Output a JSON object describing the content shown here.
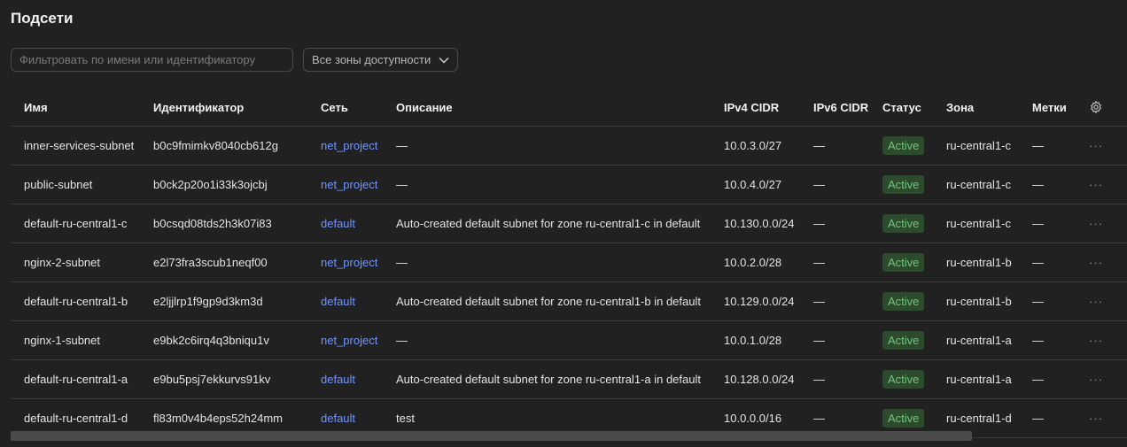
{
  "page": {
    "title": "Подсети"
  },
  "filter": {
    "placeholder": "Фильтровать по имени или идентификатору"
  },
  "zone_select": {
    "value": "Все зоны доступности",
    "icon": "chevron-down-icon"
  },
  "table": {
    "columns": [
      "Имя",
      "Идентификатор",
      "Сеть",
      "Описание",
      "IPv4 CIDR",
      "IPv6 CIDR",
      "Статус",
      "Зона",
      "Метки"
    ],
    "settings_icon": "gear-icon",
    "rows": [
      {
        "name": "inner-services-subnet",
        "id": "b0c9fmimkv8040cb612g",
        "network": "net_project",
        "description": "—",
        "ipv4": "10.0.3.0/27",
        "ipv6": "—",
        "status": "Active",
        "zone": "ru-central1-c",
        "labels": "—",
        "actions": "···"
      },
      {
        "name": "public-subnet",
        "id": "b0ck2p20o1i33k3ojcbj",
        "network": "net_project",
        "description": "—",
        "ipv4": "10.0.4.0/27",
        "ipv6": "—",
        "status": "Active",
        "zone": "ru-central1-c",
        "labels": "—",
        "actions": "···"
      },
      {
        "name": "default-ru-central1-c",
        "id": "b0csqd08tds2h3k07i83",
        "network": "default",
        "description": "Auto-created default subnet for zone ru-central1-c in default",
        "ipv4": "10.130.0.0/24",
        "ipv6": "—",
        "status": "Active",
        "zone": "ru-central1-c",
        "labels": "—",
        "actions": "···"
      },
      {
        "name": "nginx-2-subnet",
        "id": "e2l73fra3scub1neqf00",
        "network": "net_project",
        "description": "—",
        "ipv4": "10.0.2.0/28",
        "ipv6": "—",
        "status": "Active",
        "zone": "ru-central1-b",
        "labels": "—",
        "actions": "···"
      },
      {
        "name": "default-ru-central1-b",
        "id": "e2ljjlrp1f9gp9d3km3d",
        "network": "default",
        "description": "Auto-created default subnet for zone ru-central1-b in default",
        "ipv4": "10.129.0.0/24",
        "ipv6": "—",
        "status": "Active",
        "zone": "ru-central1-b",
        "labels": "—",
        "actions": "···"
      },
      {
        "name": "nginx-1-subnet",
        "id": "e9bk2c6irq4q3bniqu1v",
        "network": "net_project",
        "description": "—",
        "ipv4": "10.0.1.0/28",
        "ipv6": "—",
        "status": "Active",
        "zone": "ru-central1-a",
        "labels": "—",
        "actions": "···"
      },
      {
        "name": "default-ru-central1-a",
        "id": "e9bu5psj7ekkurvs91kv",
        "network": "default",
        "description": "Auto-created default subnet for zone ru-central1-a in default",
        "ipv4": "10.128.0.0/24",
        "ipv6": "—",
        "status": "Active",
        "zone": "ru-central1-a",
        "labels": "—",
        "actions": "···"
      },
      {
        "name": "default-ru-central1-d",
        "id": "fl83m0v4b4eps52h24mm",
        "network": "default",
        "description": "test",
        "ipv4": "10.0.0.0/16",
        "ipv6": "—",
        "status": "Active",
        "zone": "ru-central1-d",
        "labels": "—",
        "actions": "···"
      }
    ]
  },
  "colors": {
    "background": "#212121",
    "link": "#7196ff",
    "status_bg": "#2d4a2f",
    "status_text": "#73c47a"
  }
}
